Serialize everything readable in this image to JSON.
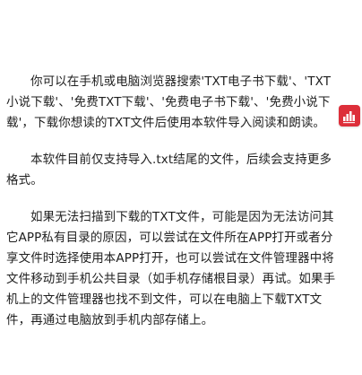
{
  "help": {
    "paragraphs": [
      "你可以在手机或电脑浏览器搜索'TXT电子书下载'、'TXT小说下载'、'免费TXT下载'、'免费电子书下载'、'免费小说下载'，下载你想读的TXT文件后使用本软件导入阅读和朗读。",
      "本软件目前仅支持导入.txt结尾的文件，后续会支持更多格式。",
      "如果无法扫描到下载的TXT文件，可能是因为无法访问其它APP私有目录的原因，可以尝试在文件所在APP打开或者分享文件时选择使用本APP打开，也可以尝试在文件管理器中将文件移动到手机公共目录（如手机存储根目录）再试。如果手机上的文件管理器也找不到文件，可以在电脑上下载TXT文件，再通过电脑放到手机内部存储上。"
    ]
  },
  "floating_button": {
    "icon": "equalizer-bars-icon",
    "color": "#dd2f3a"
  }
}
